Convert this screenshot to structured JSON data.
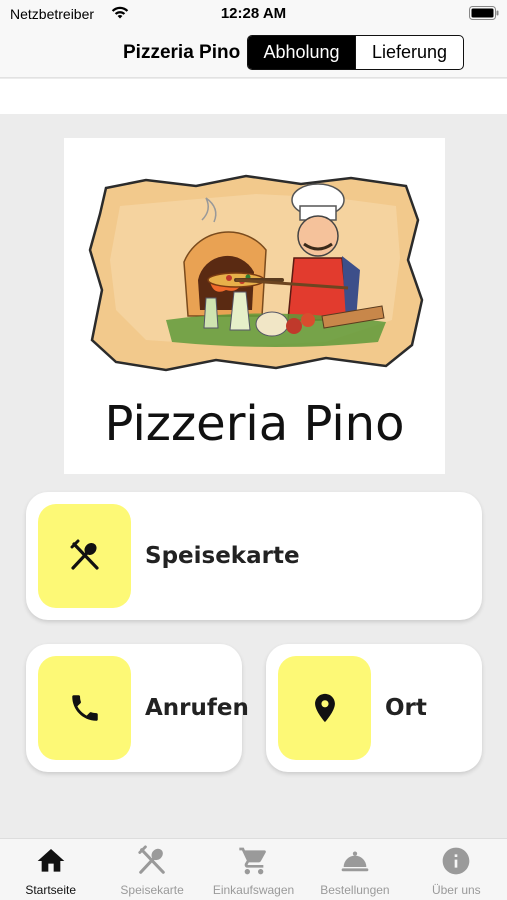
{
  "status_bar": {
    "carrier": "Netzbetreiber",
    "time": "12:28 AM"
  },
  "header": {
    "title": "Pizzeria Pino",
    "segments": [
      {
        "label": "Abholung",
        "active": true
      },
      {
        "label": "Lieferung",
        "active": false
      }
    ]
  },
  "logo": {
    "text": "Pizzeria Pino"
  },
  "actions": {
    "menu": {
      "label": "Speisekarte",
      "icon": "fork-spoon-icon"
    },
    "call": {
      "label": "Anrufen",
      "icon": "phone-icon"
    },
    "location": {
      "label": "Ort",
      "icon": "location-pin-icon"
    }
  },
  "tabbar": {
    "items": [
      {
        "label": "Startseite",
        "icon": "home-icon",
        "active": true
      },
      {
        "label": "Speisekarte",
        "icon": "fork-spoon-icon",
        "active": false
      },
      {
        "label": "Einkaufswagen",
        "icon": "cart-icon",
        "active": false
      },
      {
        "label": "Bestellungen",
        "icon": "cloche-icon",
        "active": false
      },
      {
        "label": "Über uns",
        "icon": "info-icon",
        "active": false
      }
    ]
  },
  "colors": {
    "accent_tile": "#fdf976",
    "active": "#000000",
    "inactive": "#9a9a9a"
  }
}
